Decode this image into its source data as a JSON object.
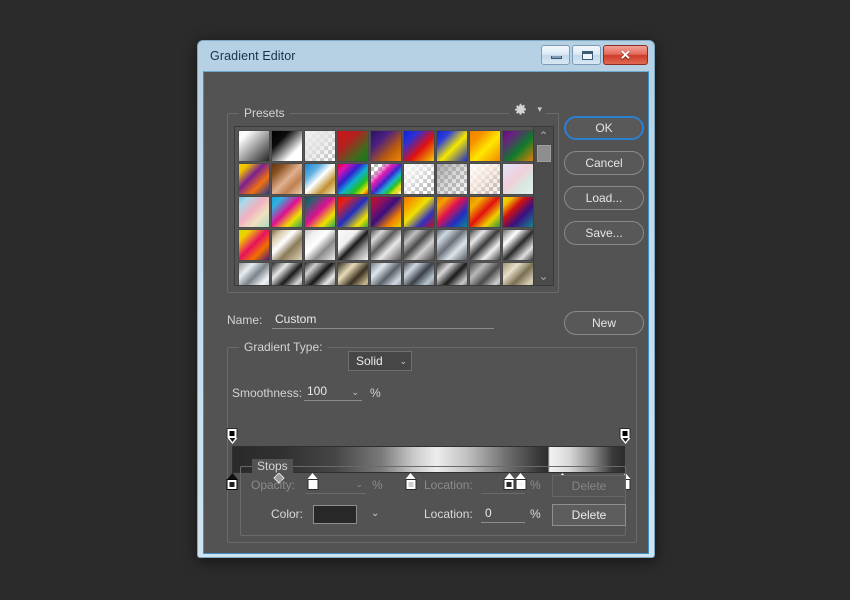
{
  "window": {
    "title": "Gradient Editor",
    "buttons": {
      "minimize": "minimize-icon",
      "maximize": "maximize-icon",
      "close": "✕"
    }
  },
  "presets": {
    "label": "Presets",
    "gear_icon": "gear-icon",
    "gear_caret": "▾",
    "scroll_up": "⌃",
    "scroll_down": "⌄",
    "swatches": [
      {
        "name": "foreground-to-background",
        "css": "linear-gradient(135deg,#f2f2f2 0%,#ffffff 18%,#9a9a9a 55%,#1d1d1d 100%)"
      },
      {
        "name": "foreground-to-transparent",
        "css": "linear-gradient(135deg,#000000 0%,#0b0b0b 30%,#ffffff 72%,#ffffff 100%)"
      },
      {
        "name": "black-white-checker",
        "checker": true,
        "css": "linear-gradient(135deg,rgba(240,240,240,1) 0%,rgba(230,230,230,0.85) 45%,rgba(255,255,255,0) 100%)"
      },
      {
        "name": "red-green",
        "css": "linear-gradient(135deg,#d01515 0%,#b42020 35%,#3f6b1e 72%,#0c7a18 100%)"
      },
      {
        "name": "violet-orange",
        "css": "linear-gradient(135deg,#2a1060 0%,#4a2080 32%,#b85a10 66%,#f58a00 100%)"
      },
      {
        "name": "blue-red-yellow",
        "css": "linear-gradient(135deg,#1020d0 0%,#2a30d8 25%,#e01010 58%,#f5e000 100%)"
      },
      {
        "name": "blue-yellow-blue",
        "css": "linear-gradient(135deg,#1020d0 0%,#3040d8 25%,#f5e800 55%,#1020d0 100%)"
      },
      {
        "name": "orange-yellow-orange",
        "css": "linear-gradient(135deg,#f08000 0%,#f59000 25%,#ffe800 55%,#f08000 100%)"
      },
      {
        "name": "violet-green-orange",
        "css": "linear-gradient(135deg,#5a1070 0%,#6a2080 22%,#0f7a2a 58%,#f08000 100%)"
      },
      {
        "name": "yellow-violet-orange-blue",
        "css": "linear-gradient(135deg,#f5d000 0%,#f0c000 18%,#7a2090 42%,#f07010 68%,#1030a0 100%)"
      },
      {
        "name": "copper",
        "css": "linear-gradient(135deg,#5a3010 0%,#8a5020 22%,#e0b090 50%,#c08050 70%,#f0d8c0 100%)"
      },
      {
        "name": "chrome-blue",
        "css": "linear-gradient(135deg,#1080d0 0%,#60b0e0 28%,#ffffff 48%,#c09030 72%,#fff4d0 100%)"
      },
      {
        "name": "spectrum",
        "css": "linear-gradient(135deg,#e00000 0%,#e010b0 18%,#3020d0 38%,#10b0d0 55%,#20c020 72%,#f0e000 86%,#e00000 100%)"
      },
      {
        "name": "transparent-rainbow",
        "checker": true,
        "css": "linear-gradient(135deg,rgba(224,0,0,0) 0%,rgba(224,0,0,0) 20%,rgba(224,16,176,.95) 38%,rgba(48,32,208,.95) 52%,rgba(16,176,208,.95) 64%,rgba(32,192,32,.95) 74%,rgba(240,224,0,.95) 84%,rgba(255,255,255,0) 100%)"
      },
      {
        "name": "noise-white",
        "checker": true,
        "css": "linear-gradient(135deg,rgba(255,255,255,.95) 0%,rgba(245,245,245,.7) 40%,rgba(255,255,255,0) 78%)"
      },
      {
        "name": "transparent-gray",
        "checker": true,
        "css": "linear-gradient(135deg,rgba(150,150,150,.85) 0%,rgba(170,170,170,.5) 45%,rgba(255,255,255,0) 100%)"
      },
      {
        "name": "skin-tone-transparent",
        "checker": true,
        "css": "linear-gradient(135deg,rgba(255,255,255,.95) 0%,rgba(250,235,225,.8) 45%,rgba(230,200,185,.35) 75%,rgba(255,255,255,0) 100%)"
      },
      {
        "name": "pastel-rainbow",
        "css": "linear-gradient(135deg,#dfe8f5 0%,#e8d8ea 25%,#f0d0d8 45%,#d8e8e0 68%,#e8f0f5 100%)"
      },
      {
        "name": "pastel-pink-blue",
        "css": "linear-gradient(135deg,#60c0e8 0%,#b0d8e8 18%,#f0b0c0 45%,#f0e0c0 68%,#a8d8c0 100%)"
      },
      {
        "name": "cyan-magenta-green",
        "css": "linear-gradient(135deg,#10a0d8 0%,#30b0e0 20%,#e01090 48%,#f0e000 72%,#10a060 100%)"
      },
      {
        "name": "teal-magenta-green",
        "css": "linear-gradient(135deg,#1a4a5a 0%,#2a6070 18%,#e01090 48%,#f0e000 74%,#10a060 100%)"
      },
      {
        "name": "red-blue-yellow-green",
        "css": "linear-gradient(135deg,#d81010 0%,#e02020 20%,#2030c0 50%,#f0e000 78%,#10a040 100%)"
      },
      {
        "name": "red-violet-orange-yellow",
        "css": "linear-gradient(135deg,#d01010 0%,#8a1060 28%,#3a1080 48%,#f08000 74%,#e8e000 100%)"
      },
      {
        "name": "orange-yellow-red",
        "css": "linear-gradient(135deg,#f07000 0%,#f5a000 22%,#f0e000 44%,#3030c0 72%,#d81010 100%)"
      },
      {
        "name": "orange-blue-teal",
        "css": "linear-gradient(135deg,#f07000 0%,#f0a000 20%,#e01050 44%,#2030c0 70%,#109090 100%)"
      },
      {
        "name": "orange-red-green",
        "css": "linear-gradient(135deg,#f08000 0%,#f0b000 22%,#e01010 48%,#f0d000 72%,#109040 100%)"
      },
      {
        "name": "yellow-violet-teal",
        "css": "linear-gradient(135deg,#f0e000 0%,#f0c000 18%,#d01010 38%,#3a1080 62%,#109090 100%)"
      },
      {
        "name": "yellow-pink-violet",
        "css": "linear-gradient(135deg,#c8e000 0%,#f0d000 20%,#e81060 48%,#f07000 70%,#3a1080 100%)"
      },
      {
        "name": "brass",
        "css": "linear-gradient(135deg,#6a5a40 0%,#d8c8a8 20%,#ffffff 40%,#8a7a58 62%,#e8dcc0 100%)"
      },
      {
        "name": "silver",
        "css": "linear-gradient(135deg,#b8b8b8 0%,#f0f0f0 22%,#ffffff 42%,#8a8a8a 65%,#f5f5f5 100%)"
      },
      {
        "name": "black-white-steel",
        "css": "linear-gradient(135deg,#fafafa 0%,#f0f0f0 35%,#1a1a1a 52%,#9a9a9a 72%,#ffffff 100%)"
      },
      {
        "name": "steel-bar",
        "css": "linear-gradient(135deg,#3a3a3a 0%,#d8d8d8 22%,#5a5a5a 42%,#e8e8e8 62%,#4a4a4a 100%)"
      },
      {
        "name": "dark-steel",
        "css": "linear-gradient(135deg,#2e2e2e 0%,#c0c0c0 25%,#4a4a4a 45%,#d0d0d0 65%,#3a3a3a 100%)"
      },
      {
        "name": "blue-steel",
        "css": "linear-gradient(135deg,#4a5058 0%,#cfd8e0 22%,#6a7078 45%,#dde4ea 66%,#454b52 100%)"
      },
      {
        "name": "polished-chrome",
        "css": "linear-gradient(135deg,#2a2a2a 0%,#e8e8e8 26%,#3a3a3a 48%,#f0f0f0 70%,#2a2a2a 100%)"
      },
      {
        "name": "bright-chrome",
        "css": "linear-gradient(135deg,#5a5a5a 0%,#ffffff 28%,#2a2a2a 52%,#e0e0e0 76%,#1f1f1f 100%)"
      },
      {
        "name": "pale-chrome",
        "css": "linear-gradient(135deg,#8a8a8a 0%,#e8eef2 26%,#7a8288 48%,#f0f4f8 72%,#9aa0a4 100%)"
      },
      {
        "name": "black-silver",
        "css": "linear-gradient(135deg,#121212 0%,#e8e8e8 28%,#1a1a1a 52%,#d8d8d8 74%,#101010 100%)"
      },
      {
        "name": "dark-silver",
        "css": "linear-gradient(135deg,#0f0f0f 0%,#d0d0d0 22%,#141414 46%,#e8e8e8 68%,#0d0d0d 100%)"
      },
      {
        "name": "gold-dark",
        "css": "linear-gradient(135deg,#201a10 0%,#e8dcb8 30%,#3a3020 55%,#c8b890 78%,#1a1510 100%)"
      },
      {
        "name": "blue-chrome",
        "css": "linear-gradient(135deg,#6a7078 0%,#dfe8ee 26%,#5a6068 50%,#cfd8e0 72%,#555b62 100%)"
      },
      {
        "name": "steel-blue",
        "css": "linear-gradient(135deg,#30343a 0%,#cfd8e2 24%,#3a4048 48%,#b8c4d0 70%,#282c32 100%)"
      },
      {
        "name": "night-chrome",
        "css": "linear-gradient(135deg,#141414 0%,#d8d8d8 26%,#1a1a1a 50%,#c8c8c8 74%,#0f0f0f 100%)"
      },
      {
        "name": "soft-chrome",
        "css": "linear-gradient(135deg,#3a3a3a 0%,#b8b8b8 28%,#4a4a4a 52%,#d0d0d0 76%,#2a2a2a 100%)"
      },
      {
        "name": "sand-chrome",
        "css": "linear-gradient(135deg,#9a8a68 0%,#e8e0cc 28%,#7a6e50 52%,#d8d0b8 76%,#8a8068 100%)"
      }
    ]
  },
  "name_row": {
    "label": "Name:",
    "value": "Custom",
    "placeholder": "Custom"
  },
  "side_buttons": {
    "ok": "OK",
    "cancel": "Cancel",
    "load": "Load...",
    "save": "Save...",
    "new": "New"
  },
  "gradient": {
    "type_label": "Gradient Type:",
    "type_value": "Solid",
    "type_caret": "⌄",
    "smoothness_label": "Smoothness:",
    "smoothness_value": "100",
    "smoothness_caret": "⌄",
    "smoothness_unit": "%",
    "bar_css": "linear-gradient(90deg,#2a2a2a 0%,#303030 12%,#454545 26%,#7a7a7a 38%,#c8c8c8 46%,#ededed 52%,#c0c0c0 60%,#6e6e6e 70%,#3a3a3a 78%,#2e2e2e 80.5%,#f2f2f2 81%,#d8d8d8 86%,#8a8a8a 92%,#3a3a3a 97%,#2c2c2c 100%)",
    "opacity_stops": [
      {
        "name": "opacity-stop-0",
        "pos": 0,
        "opacity": 100
      },
      {
        "name": "opacity-stop-100",
        "pos": 100,
        "opacity": 100
      }
    ],
    "color_stops": [
      {
        "name": "color-stop-0",
        "pos": 0,
        "color": "#1f1f1f",
        "selected": true
      },
      {
        "name": "color-stop-1",
        "pos": 20.5,
        "color": "#ffffff",
        "selected": false
      },
      {
        "name": "color-stop-2",
        "pos": 45.5,
        "color": "#cfcfcf",
        "selected": false
      },
      {
        "name": "color-stop-3",
        "pos": 70.5,
        "color": "#2a2a2a",
        "selected": false
      },
      {
        "name": "color-stop-4",
        "pos": 73.5,
        "color": "#f5f5f5",
        "selected": false
      },
      {
        "name": "color-stop-5",
        "pos": 84.0,
        "color": "#ffffff",
        "selected": false
      },
      {
        "name": "color-stop-6",
        "pos": 100,
        "color": "#ffffff",
        "selected": false
      }
    ],
    "midpoints": [
      {
        "name": "midpoint-marker-1",
        "pos": 12
      }
    ]
  },
  "stops": {
    "label": "Stops",
    "opacity": {
      "label": "Opacity:",
      "value": "",
      "caret": "⌄",
      "unit": "%",
      "location_label": "Location:",
      "location_value": "",
      "location_unit": "%",
      "delete_label": "Delete",
      "enabled": false
    },
    "color": {
      "label": "Color:",
      "swatch_color": "#282828",
      "caret": "⌄",
      "location_label": "Location:",
      "location_value": "0",
      "location_unit": "%",
      "delete_label": "Delete",
      "enabled": true
    }
  }
}
